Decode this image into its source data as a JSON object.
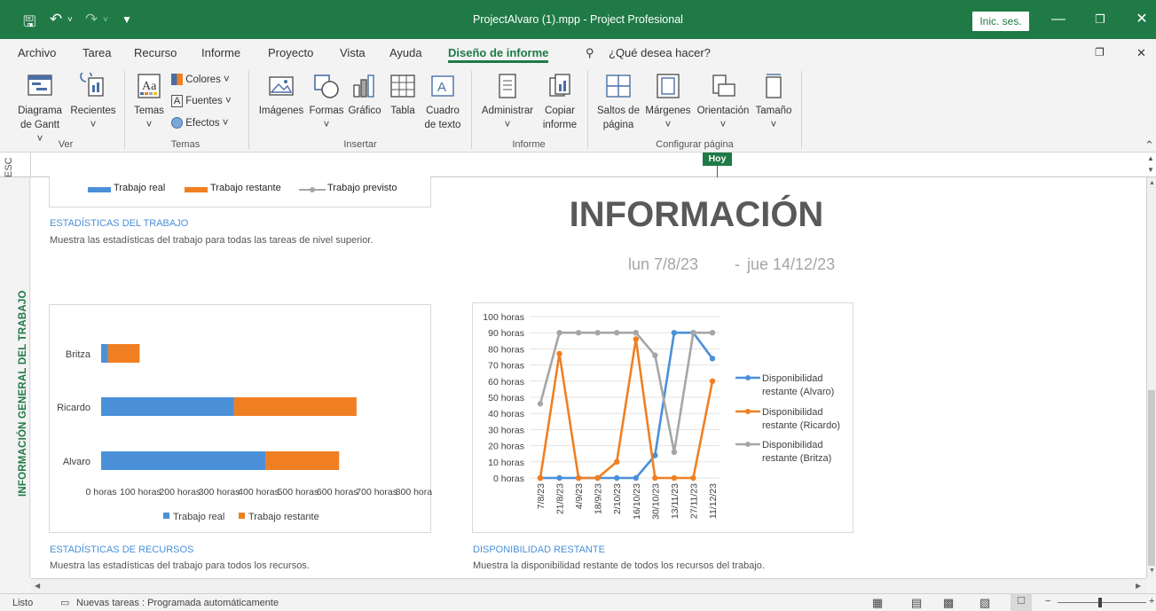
{
  "titlebar": {
    "title": "ProjectAlvaro (1).mpp  -  Project Profesional",
    "signin": "Inic. ses."
  },
  "menu": {
    "items": [
      "Archivo",
      "Tarea",
      "Recurso",
      "Informe",
      "Proyecto",
      "Vista",
      "Ayuda",
      "Diseño de informe"
    ],
    "search_placeholder": "¿Qué desea hacer?"
  },
  "ribbon": {
    "ver": {
      "group": "Ver",
      "gantt_l1": "Diagrama",
      "gantt_l2": "de Gantt ˅",
      "recent_l1": "Recientes",
      "recent_l2": "˅"
    },
    "temas": {
      "group": "Temas",
      "temas": "Temas",
      "temas_arrow": "˅",
      "colores": "Colores ˅",
      "fuentes": "Fuentes ˅",
      "efectos": "Efectos ˅"
    },
    "insertar": {
      "group": "Insertar",
      "imagenes": "Imágenes",
      "formas": "Formas",
      "formas_arrow": "˅",
      "grafico": "Gráfico",
      "tabla": "Tabla",
      "cuadro_l1": "Cuadro",
      "cuadro_l2": "de texto"
    },
    "informe": {
      "group": "Informe",
      "administrar": "Administrar",
      "administrar_arrow": "˅",
      "copiar_l1": "Copiar",
      "copiar_l2": "informe"
    },
    "configurar": {
      "group": "Configurar página",
      "saltos_l1": "Saltos de",
      "saltos_l2": "página",
      "margenes": "Márgenes",
      "margenes_arrow": "˅",
      "orientacion": "Orientación",
      "orientacion_arrow": "˅",
      "tamano": "Tamaño",
      "tamano_arrow": "˅"
    }
  },
  "timeline": {
    "left_label": "ESC",
    "today_label": "Hoy"
  },
  "report": {
    "side_title": "INFORMACIÓN GENERAL DEL TRABAJO",
    "title": "INFORMACIÓN",
    "date_start": "lun 7/8/23",
    "date_end": "jue 14/12/23",
    "top_legend": [
      "Trabajo real",
      "Trabajo restante",
      "Trabajo previsto"
    ],
    "work_stats_title": "ESTADÍSTICAS DEL TRABAJO",
    "work_stats_desc": "Muestra las estadísticas del trabajo para todas las tareas de nivel superior.",
    "resource_stats_title": "ESTADÍSTICAS DE RECURSOS",
    "resource_stats_desc": "Muestra las estadísticas del trabajo para todos los recursos.",
    "availability_title": "DISPONIBILIDAD RESTANTE",
    "availability_desc": "Muestra la disponibilidad restante de todos los recursos del trabajo."
  },
  "status": {
    "ready": "Listo",
    "new_tasks": "Nuevas tareas : Programada automáticamente"
  },
  "colors": {
    "accent": "#1f7a46",
    "series_blue": "#4a90d9",
    "series_orange": "#f07f22",
    "series_gray": "#a6a6a6"
  },
  "chart_data": [
    {
      "type": "bar",
      "orientation": "horizontal",
      "stacked": true,
      "categories": [
        "Britza",
        "Ricardo",
        "Alvaro"
      ],
      "series": [
        {
          "name": "Trabajo real",
          "values": [
            20,
            380,
            470
          ]
        },
        {
          "name": "Trabajo restante",
          "values": [
            90,
            350,
            210
          ]
        }
      ],
      "xlim": [
        0,
        900
      ],
      "x_ticks": [
        "0 horas",
        "100 horas",
        "200 horas",
        "300 horas",
        "400 horas",
        "500 horas",
        "600 horas",
        "700 horas",
        "800 horas"
      ],
      "legend": "bottom"
    },
    {
      "type": "line",
      "categories": [
        "7/8/23",
        "21/8/23",
        "4/9/23",
        "18/9/23",
        "2/10/23",
        "16/10/23",
        "30/10/23",
        "13/11/23",
        "27/11/23",
        "11/12/23"
      ],
      "series": [
        {
          "name": "Disponibilidad restante (Alvaro)",
          "values": [
            0,
            0,
            0,
            0,
            0,
            0,
            14,
            90,
            90,
            74
          ]
        },
        {
          "name": "Disponibilidad restante (Ricardo)",
          "values": [
            0,
            77,
            0,
            0,
            10,
            86,
            0,
            0,
            0,
            60
          ]
        },
        {
          "name": "Disponibilidad restante (Britza)",
          "values": [
            46,
            90,
            90,
            90,
            90,
            90,
            76,
            16,
            90,
            90
          ]
        }
      ],
      "ylim": [
        0,
        100
      ],
      "y_ticks": [
        "0 horas",
        "10 horas",
        "20 horas",
        "30 horas",
        "40 horas",
        "50 horas",
        "60 horas",
        "70 horas",
        "80 horas",
        "90 horas",
        "100 horas"
      ],
      "legend": "right"
    }
  ]
}
